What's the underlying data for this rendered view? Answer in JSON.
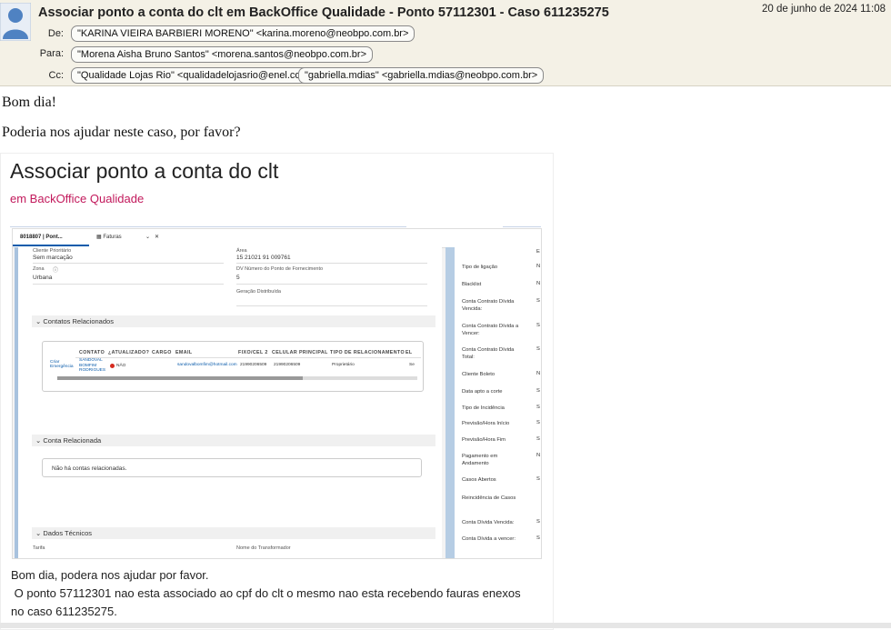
{
  "email": {
    "subject": "Associar ponto a conta do clt em BackOffice Qualidade - Ponto 57112301 - Caso 611235275",
    "date": "20 de junho de 2024 11:08",
    "from_label": "De:",
    "from": "\"KARINA VIEIRA BARBIERI MORENO\" <karina.moreno@neobpo.com.br>",
    "to_label": "Para:",
    "to": "\"Morena Aisha Bruno Santos\" <morena.santos@neobpo.com.br>",
    "cc_label": "Cc:",
    "cc": [
      "\"Qualidade Lojas Rio\" <qualidadelojasrio@enel.com>",
      "\"gabriella.mdias\" <gabriella.mdias@neobpo.com.br>"
    ],
    "greeting": "Bom dia!",
    "request": "Poderia nos ajudar neste caso, por favor?"
  },
  "card": {
    "title": "Associar ponto a conta do clt",
    "subtitle": "em BackOffice Qualidade",
    "message_line1": "Bom dia, podera nos ajudar por favor.",
    "message_line2": " O ponto 57112301 nao esta associado ao cpf do clt o mesmo nao esta recebendo fauras enexos",
    "message_line3": "no caso 611235275."
  },
  "screenshot": {
    "tab1": "8018807 | Pont...",
    "tab2": "Faturas",
    "fields_left": [
      {
        "label": "Cliente Prioritário",
        "value": "Sem marcação"
      },
      {
        "label": "Zona",
        "value": "Urbana"
      }
    ],
    "fields_right": [
      {
        "label": "Área",
        "value": "15 21021 91 009761"
      },
      {
        "label": "DV Número do Ponto de Fornecimento",
        "value": "5"
      },
      {
        "label": "Geração Distribuída",
        "value": ""
      }
    ],
    "section_contacts": "Contatos Relacionados",
    "table_headers": [
      "CONTATO",
      "¿ATUALIZADO?",
      "CARGO",
      "EMAIL",
      "FIXO/CEL 2",
      "CELULAR PRINCIPAL",
      "TIPO DE RELACIONAMENTO",
      "EL"
    ],
    "row": {
      "action": "Criar Emergência",
      "contact": "SANDOVAL BOMFIM RODRIGUES",
      "updated": "NÃO",
      "email": "sandovalbomfim@hotmail.com",
      "fixed": "21990206509",
      "mobile": "21990206509",
      "relation": "Proprietário",
      "extra": "Se"
    },
    "section_account": "Conta Relacionada",
    "no_accounts": "Não há contas relacionadas.",
    "section_tech": "Dados Técnicos",
    "tech_left": "Tarifa",
    "tech_right": "Nome do Transformador",
    "right_labels": [
      "Tipo de ligação",
      "Blacklist",
      "Conta Contrato Dívida Vencida:",
      "Conta Contrato Dívida a Vencer:",
      "Conta Contrato Dívida Total:",
      "Cliente Boleto",
      "Data apto a corte",
      "Tipo de Incidência",
      "Previsão/Hora Início",
      "Previsão/Hora Fim",
      "Pagamento em Andamento",
      "Casos Abertos",
      "Reincidência de Casos",
      "Conta Dívida Vencida:",
      "Conta Dívida a vencer:"
    ],
    "right_values": [
      "E",
      "N",
      "N",
      "S",
      "S",
      "S",
      "N",
      "S",
      "S",
      "S",
      "S",
      "N",
      "S",
      "",
      "S",
      "S"
    ]
  },
  "colors": {
    "header_bg": "#f4f1e6",
    "subtitle": "#c2185b",
    "link": "#0b5cab"
  }
}
